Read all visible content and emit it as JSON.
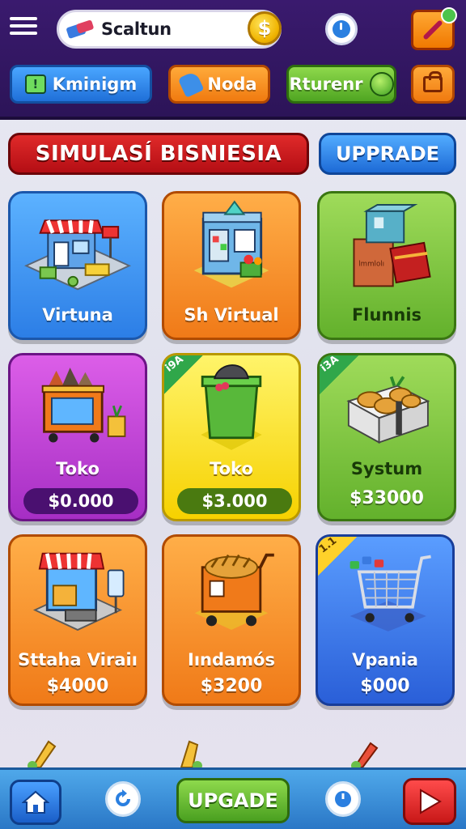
{
  "header": {
    "app_title": "Scaltun",
    "coin_symbol": "$",
    "nav": [
      {
        "label": "Kminigm",
        "icon": "warning-icon"
      },
      {
        "label": "Noda",
        "icon": "hand-icon"
      },
      {
        "label": "Rturenr",
        "icon": "globe-icon"
      },
      {
        "label": "",
        "icon": "bag-icon"
      }
    ]
  },
  "section": {
    "title": "SIMULASÍ BISNIESIA",
    "upgrade_label": "UPPRADE"
  },
  "cards": [
    {
      "name": "Virtuna",
      "icon": "shop-stall-icon",
      "color": "blue"
    },
    {
      "name": "Sh Virtual",
      "icon": "vending-shop-icon",
      "color": "orange"
    },
    {
      "name": "Flunnis",
      "icon": "boxes-icon",
      "color": "green"
    },
    {
      "name": "Toko",
      "price": "$0.000",
      "icon": "market-cart-icon",
      "color": "purple"
    },
    {
      "name": "Toko",
      "price": "$3.000",
      "ribbon": "i9A",
      "icon": "trash-bin-icon",
      "color": "yellow"
    },
    {
      "name": "Systum",
      "price": "$33000",
      "ribbon": "i3A",
      "icon": "food-box-icon",
      "color": "green"
    },
    {
      "name": "Sttaha Viraiı",
      "price": "$4000",
      "icon": "kiosk-icon",
      "color": "orange"
    },
    {
      "name": "Iındamós",
      "price": "$3200",
      "icon": "bread-cart-icon",
      "color": "orange"
    },
    {
      "name": "Vpania",
      "price": "$000",
      "ribbon": "1.1",
      "icon": "shopping-cart-icon",
      "color": "navy"
    }
  ],
  "bottom": {
    "upgrade_label": "UPGADE"
  },
  "colors": {
    "topbar": "#3a1a6e",
    "banner_red": "#d01e22",
    "accent_blue": "#2c7ee6",
    "accent_green": "#63b12c"
  }
}
